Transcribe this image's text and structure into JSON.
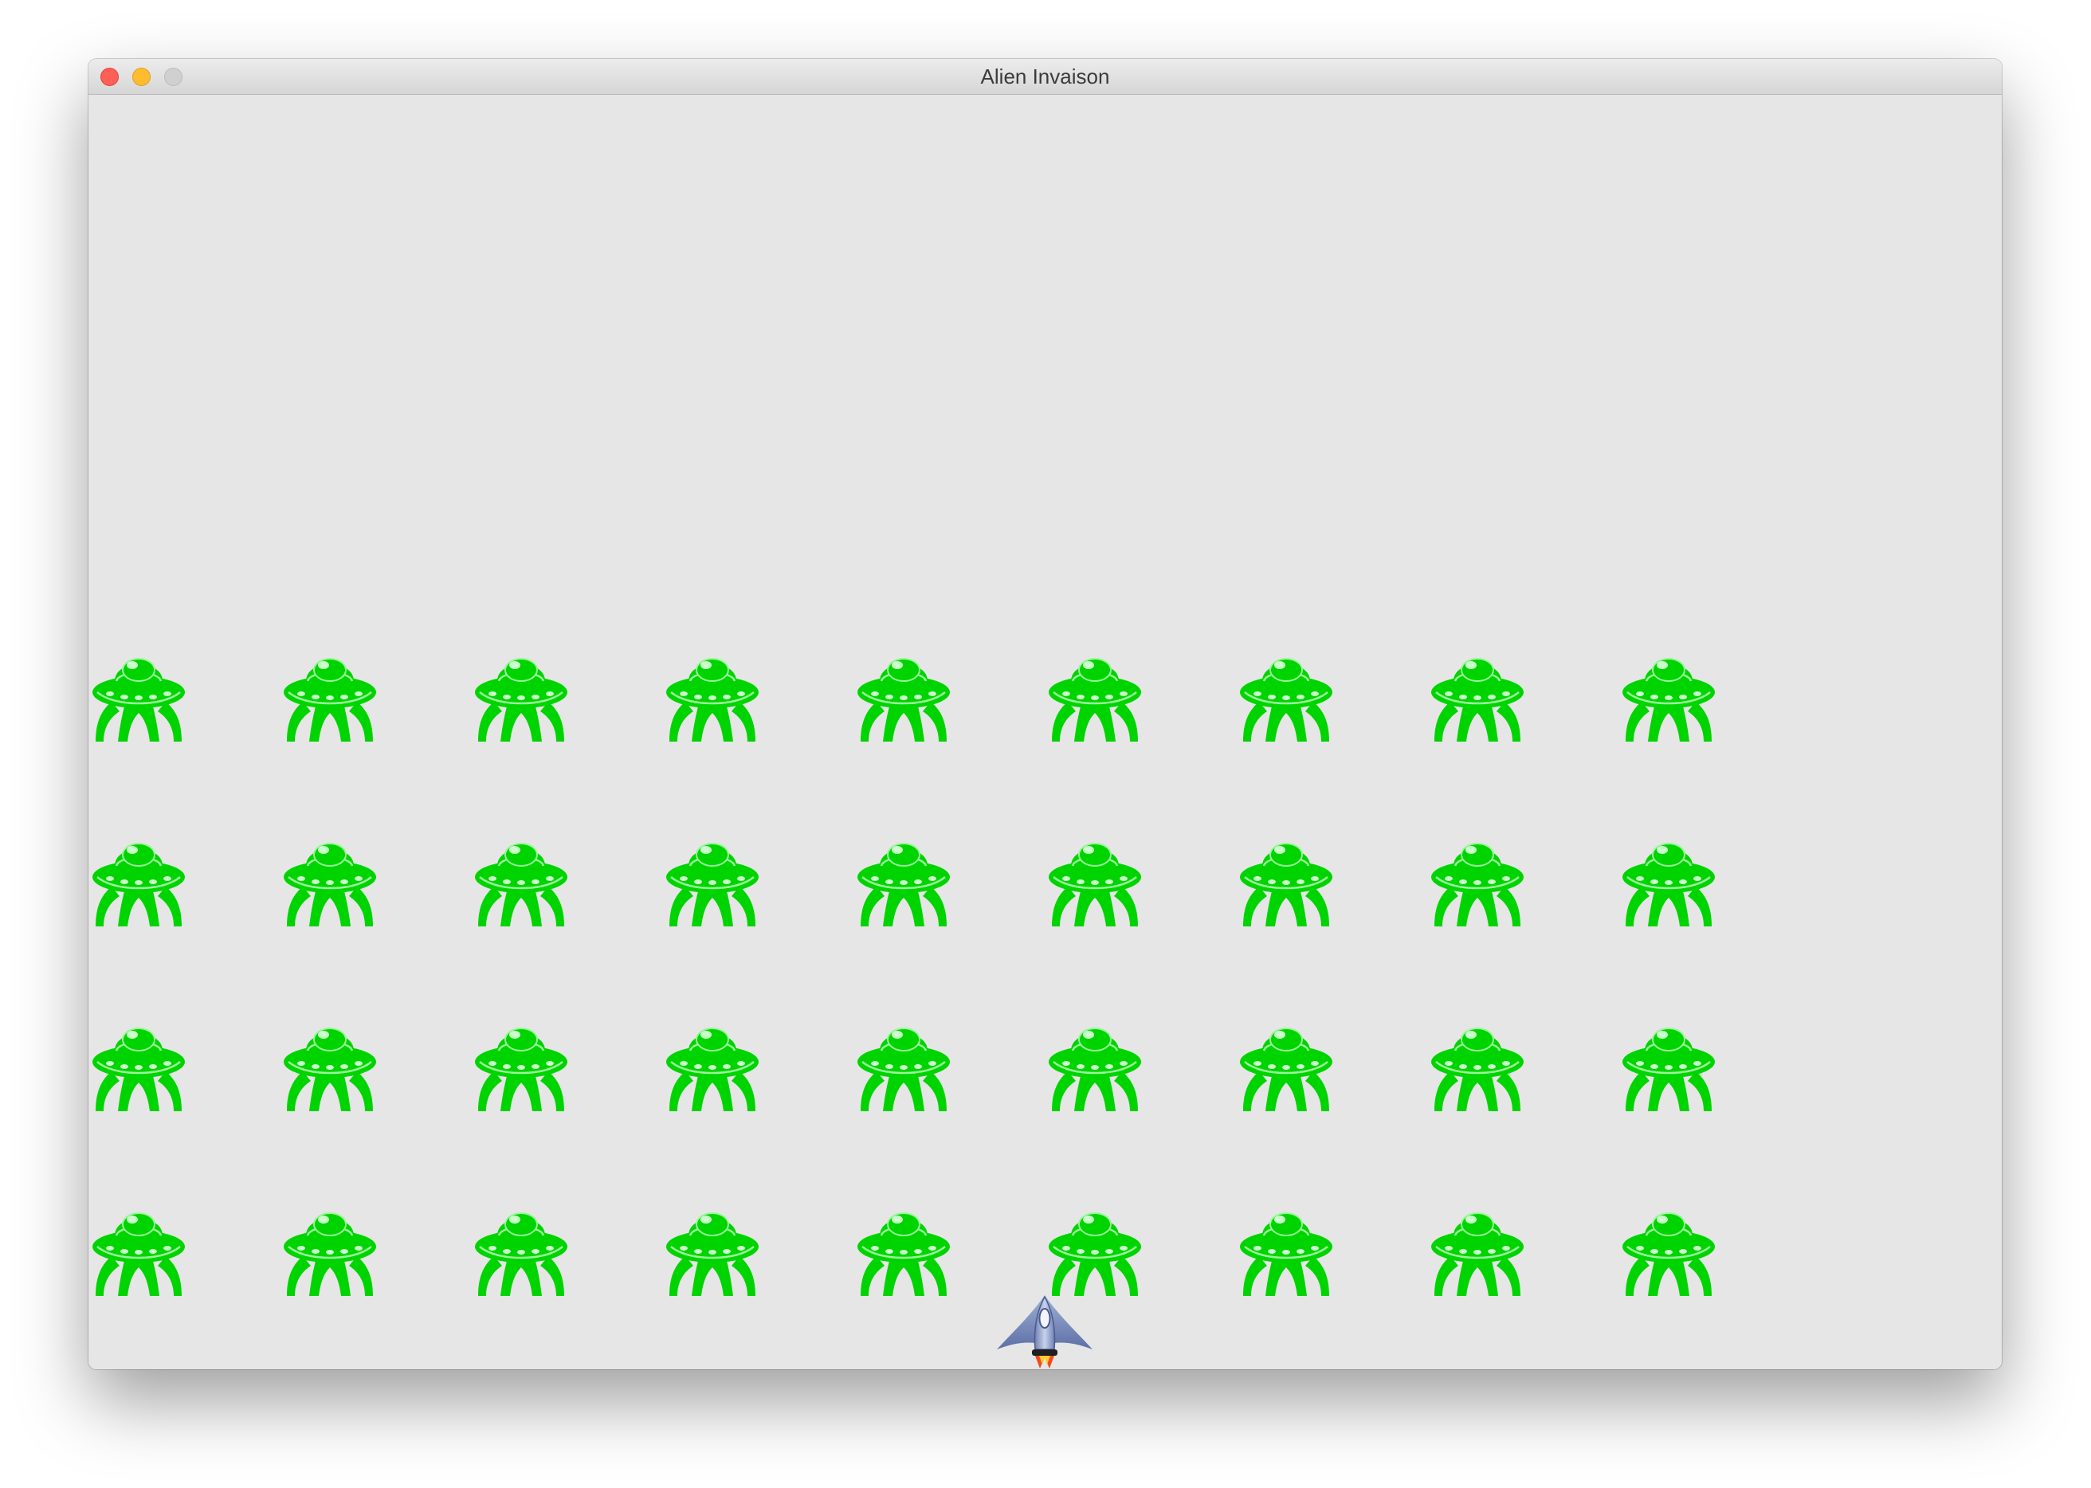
{
  "window": {
    "title": "Alien Invaison"
  },
  "game": {
    "background_color": "#e6e6e6",
    "alien_color": "#00d400",
    "alien_rows": 4,
    "alien_columns": 9,
    "ship_icon": "rocket-ship-icon",
    "alien_icon": "ufo-alien-icon"
  }
}
